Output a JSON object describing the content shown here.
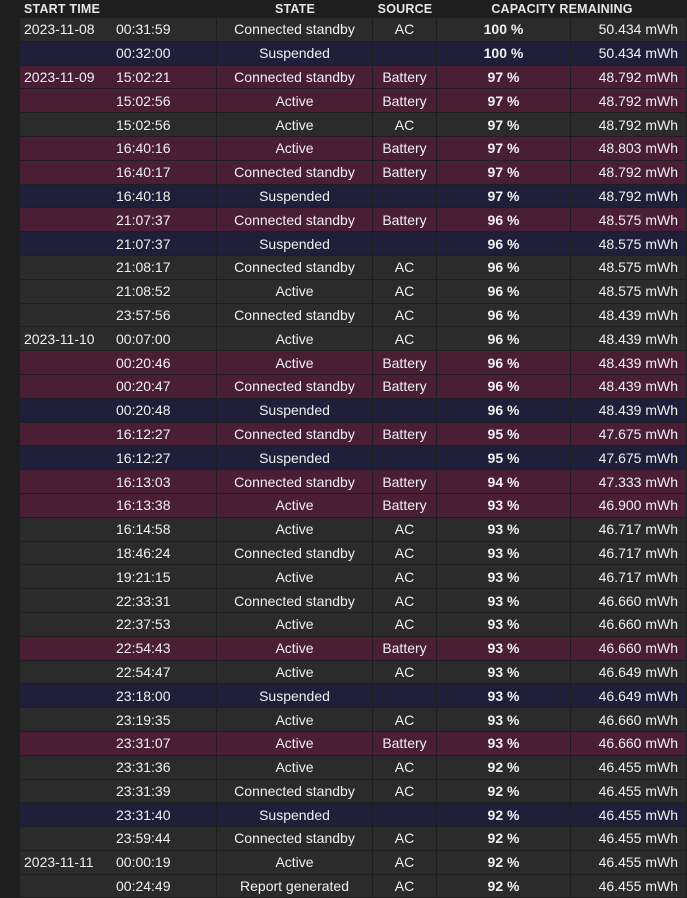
{
  "headers": {
    "start_time": "START TIME",
    "state": "STATE",
    "source": "SOURCE",
    "capacity_remaining": "CAPACITY REMAINING"
  },
  "colors": {
    "background": "#1e1e1e",
    "ac_row": "#2b2b2b",
    "battery_row": "#4a1f36",
    "suspended_row": "#1f1f3a"
  },
  "rows": [
    {
      "date": "2023-11-08",
      "time": "00:31:59",
      "state": "Connected standby",
      "source": "AC",
      "percent": "100 %",
      "capacity": "50.434 mWh",
      "kind": "ac"
    },
    {
      "date": "",
      "time": "00:32:00",
      "state": "Suspended",
      "source": "",
      "percent": "100 %",
      "capacity": "50.434 mWh",
      "kind": "susp"
    },
    {
      "date": "2023-11-09",
      "time": "15:02:21",
      "state": "Connected standby",
      "source": "Battery",
      "percent": "97 %",
      "capacity": "48.792 mWh",
      "kind": "batt"
    },
    {
      "date": "",
      "time": "15:02:56",
      "state": "Active",
      "source": "Battery",
      "percent": "97 %",
      "capacity": "48.792 mWh",
      "kind": "batt"
    },
    {
      "date": "",
      "time": "15:02:56",
      "state": "Active",
      "source": "AC",
      "percent": "97 %",
      "capacity": "48.792 mWh",
      "kind": "ac"
    },
    {
      "date": "",
      "time": "16:40:16",
      "state": "Active",
      "source": "Battery",
      "percent": "97 %",
      "capacity": "48.803 mWh",
      "kind": "batt"
    },
    {
      "date": "",
      "time": "16:40:17",
      "state": "Connected standby",
      "source": "Battery",
      "percent": "97 %",
      "capacity": "48.792 mWh",
      "kind": "batt"
    },
    {
      "date": "",
      "time": "16:40:18",
      "state": "Suspended",
      "source": "",
      "percent": "97 %",
      "capacity": "48.792 mWh",
      "kind": "susp"
    },
    {
      "date": "",
      "time": "21:07:37",
      "state": "Connected standby",
      "source": "Battery",
      "percent": "96 %",
      "capacity": "48.575 mWh",
      "kind": "batt"
    },
    {
      "date": "",
      "time": "21:07:37",
      "state": "Suspended",
      "source": "",
      "percent": "96 %",
      "capacity": "48.575 mWh",
      "kind": "susp"
    },
    {
      "date": "",
      "time": "21:08:17",
      "state": "Connected standby",
      "source": "AC",
      "percent": "96 %",
      "capacity": "48.575 mWh",
      "kind": "ac"
    },
    {
      "date": "",
      "time": "21:08:52",
      "state": "Active",
      "source": "AC",
      "percent": "96 %",
      "capacity": "48.575 mWh",
      "kind": "ac"
    },
    {
      "date": "",
      "time": "23:57:56",
      "state": "Connected standby",
      "source": "AC",
      "percent": "96 %",
      "capacity": "48.439 mWh",
      "kind": "ac"
    },
    {
      "date": "2023-11-10",
      "time": "00:07:00",
      "state": "Active",
      "source": "AC",
      "percent": "96 %",
      "capacity": "48.439 mWh",
      "kind": "ac"
    },
    {
      "date": "",
      "time": "00:20:46",
      "state": "Active",
      "source": "Battery",
      "percent": "96 %",
      "capacity": "48.439 mWh",
      "kind": "batt"
    },
    {
      "date": "",
      "time": "00:20:47",
      "state": "Connected standby",
      "source": "Battery",
      "percent": "96 %",
      "capacity": "48.439 mWh",
      "kind": "batt"
    },
    {
      "date": "",
      "time": "00:20:48",
      "state": "Suspended",
      "source": "",
      "percent": "96 %",
      "capacity": "48.439 mWh",
      "kind": "susp"
    },
    {
      "date": "",
      "time": "16:12:27",
      "state": "Connected standby",
      "source": "Battery",
      "percent": "95 %",
      "capacity": "47.675 mWh",
      "kind": "batt"
    },
    {
      "date": "",
      "time": "16:12:27",
      "state": "Suspended",
      "source": "",
      "percent": "95 %",
      "capacity": "47.675 mWh",
      "kind": "susp"
    },
    {
      "date": "",
      "time": "16:13:03",
      "state": "Connected standby",
      "source": "Battery",
      "percent": "94 %",
      "capacity": "47.333 mWh",
      "kind": "batt"
    },
    {
      "date": "",
      "time": "16:13:38",
      "state": "Active",
      "source": "Battery",
      "percent": "93 %",
      "capacity": "46.900 mWh",
      "kind": "batt"
    },
    {
      "date": "",
      "time": "16:14:58",
      "state": "Active",
      "source": "AC",
      "percent": "93 %",
      "capacity": "46.717 mWh",
      "kind": "ac"
    },
    {
      "date": "",
      "time": "18:46:24",
      "state": "Connected standby",
      "source": "AC",
      "percent": "93 %",
      "capacity": "46.717 mWh",
      "kind": "ac"
    },
    {
      "date": "",
      "time": "19:21:15",
      "state": "Active",
      "source": "AC",
      "percent": "93 %",
      "capacity": "46.717 mWh",
      "kind": "ac"
    },
    {
      "date": "",
      "time": "22:33:31",
      "state": "Connected standby",
      "source": "AC",
      "percent": "93 %",
      "capacity": "46.660 mWh",
      "kind": "ac"
    },
    {
      "date": "",
      "time": "22:37:53",
      "state": "Active",
      "source": "AC",
      "percent": "93 %",
      "capacity": "46.660 mWh",
      "kind": "ac"
    },
    {
      "date": "",
      "time": "22:54:43",
      "state": "Active",
      "source": "Battery",
      "percent": "93 %",
      "capacity": "46.660 mWh",
      "kind": "batt"
    },
    {
      "date": "",
      "time": "22:54:47",
      "state": "Active",
      "source": "AC",
      "percent": "93 %",
      "capacity": "46.649 mWh",
      "kind": "ac"
    },
    {
      "date": "",
      "time": "23:18:00",
      "state": "Suspended",
      "source": "",
      "percent": "93 %",
      "capacity": "46.649 mWh",
      "kind": "susp"
    },
    {
      "date": "",
      "time": "23:19:35",
      "state": "Active",
      "source": "AC",
      "percent": "93 %",
      "capacity": "46.660 mWh",
      "kind": "ac"
    },
    {
      "date": "",
      "time": "23:31:07",
      "state": "Active",
      "source": "Battery",
      "percent": "93 %",
      "capacity": "46.660 mWh",
      "kind": "batt"
    },
    {
      "date": "",
      "time": "23:31:36",
      "state": "Active",
      "source": "AC",
      "percent": "92 %",
      "capacity": "46.455 mWh",
      "kind": "ac"
    },
    {
      "date": "",
      "time": "23:31:39",
      "state": "Connected standby",
      "source": "AC",
      "percent": "92 %",
      "capacity": "46.455 mWh",
      "kind": "ac"
    },
    {
      "date": "",
      "time": "23:31:40",
      "state": "Suspended",
      "source": "",
      "percent": "92 %",
      "capacity": "46.455 mWh",
      "kind": "susp"
    },
    {
      "date": "",
      "time": "23:59:44",
      "state": "Connected standby",
      "source": "AC",
      "percent": "92 %",
      "capacity": "46.455 mWh",
      "kind": "ac"
    },
    {
      "date": "2023-11-11",
      "time": "00:00:19",
      "state": "Active",
      "source": "AC",
      "percent": "92 %",
      "capacity": "46.455 mWh",
      "kind": "ac"
    },
    {
      "date": "",
      "time": "00:24:49",
      "state": "Report generated",
      "source": "AC",
      "percent": "92 %",
      "capacity": "46.455 mWh",
      "kind": "gen"
    }
  ]
}
